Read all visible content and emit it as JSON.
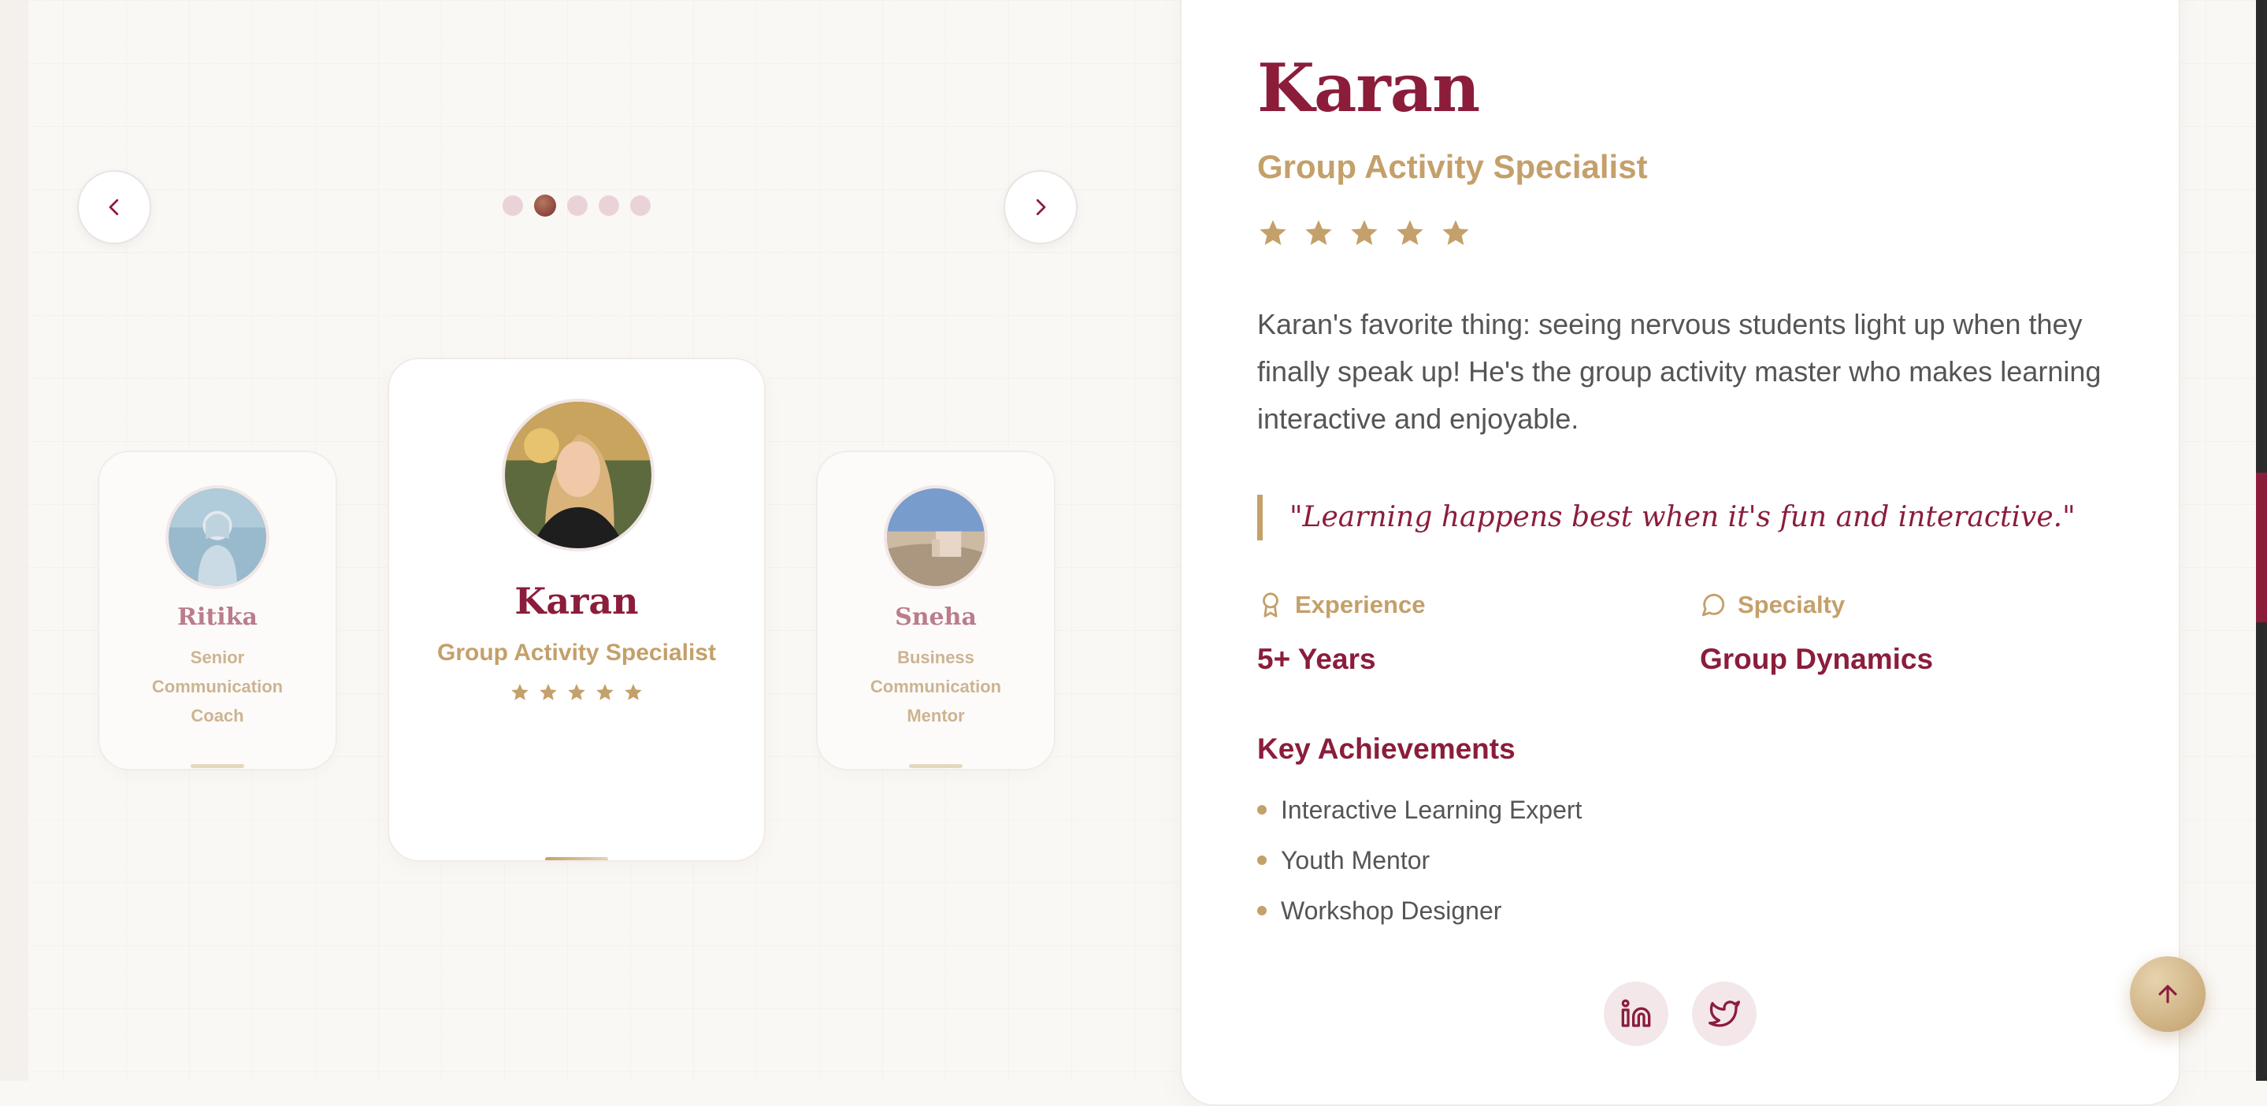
{
  "carousel": {
    "slide_count": 5,
    "active_index": 1,
    "cards": [
      {
        "name": "Ritika",
        "role": "Senior Communication Coach",
        "position": "left"
      },
      {
        "name": "Karan",
        "role": "Group Activity Specialist",
        "position": "center",
        "rating": 5
      },
      {
        "name": "Sneha",
        "role": "Business Communication Mentor",
        "position": "right"
      }
    ]
  },
  "detail": {
    "name": "Karan",
    "role": "Group Activity Specialist",
    "rating": 5,
    "bio": "Karan's favorite thing: seeing nervous students light up when they finally speak up! He's the group activity master who makes learning interactive and enjoyable.",
    "quote": "\"Learning happens best when it's fun and interactive.\"",
    "experience_label": "Experience",
    "experience_value": "5+ Years",
    "specialty_label": "Specialty",
    "specialty_value": "Group Dynamics",
    "achievements_title": "Key Achievements",
    "achievements": [
      "Interactive Learning Expert",
      "Youth Mentor",
      "Workshop Designer"
    ]
  },
  "social": [
    {
      "icon": "linkedin-icon"
    },
    {
      "icon": "twitter-icon"
    }
  ],
  "colors": {
    "primary": "#8b1d3b",
    "gold": "#c4a06a",
    "background": "#faf8f5",
    "text": "#555555"
  }
}
